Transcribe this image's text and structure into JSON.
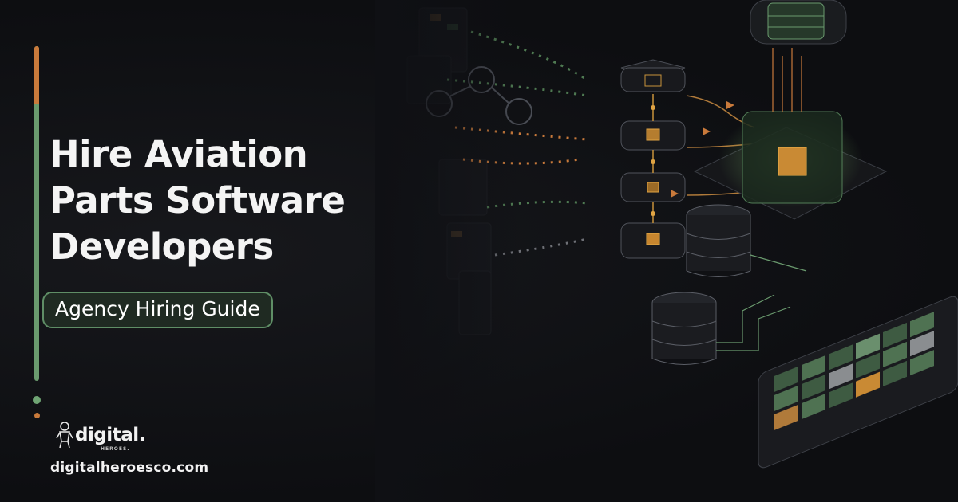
{
  "headline": {
    "line1": "Hire Aviation",
    "line2": "Parts Software",
    "line3": "Developers"
  },
  "subtitle": "Agency Hiring Guide",
  "brand": {
    "logo_word": "digital.",
    "logo_sub": "HEROES.",
    "website": "digitalheroesco.com"
  },
  "colors": {
    "background": "#0f1014",
    "accent_green": "#6a9a6e",
    "accent_orange": "#c97a3b",
    "text": "#f4f4f4"
  },
  "icons": [
    "hero-figure-icon",
    "server-stack-icon",
    "database-icon",
    "chip-cube-icon",
    "grid-panel-icon"
  ]
}
